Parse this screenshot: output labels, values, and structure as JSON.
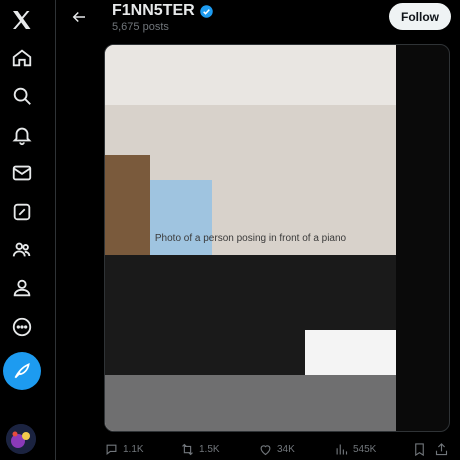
{
  "nav": {
    "items": [
      {
        "icon": "x-logo-icon"
      },
      {
        "icon": "home-icon"
      },
      {
        "icon": "search-icon"
      },
      {
        "icon": "bell-icon"
      },
      {
        "icon": "mail-icon"
      },
      {
        "icon": "grok-icon"
      },
      {
        "icon": "communities-icon"
      },
      {
        "icon": "profile-icon"
      },
      {
        "icon": "more-icon"
      }
    ],
    "post_button_icon": "feather-icon"
  },
  "header": {
    "title": "F1NN5TER",
    "post_count": "5,675 posts",
    "follow_label": "Follow"
  },
  "media": {
    "description": "Photo of a person posing in front of a piano"
  },
  "actions": {
    "replies": "1.1K",
    "reposts": "1.5K",
    "likes": "34K",
    "views": "545K"
  },
  "colors": {
    "accent": "#1d9bf0",
    "background": "#000000",
    "muted": "#71767b"
  }
}
